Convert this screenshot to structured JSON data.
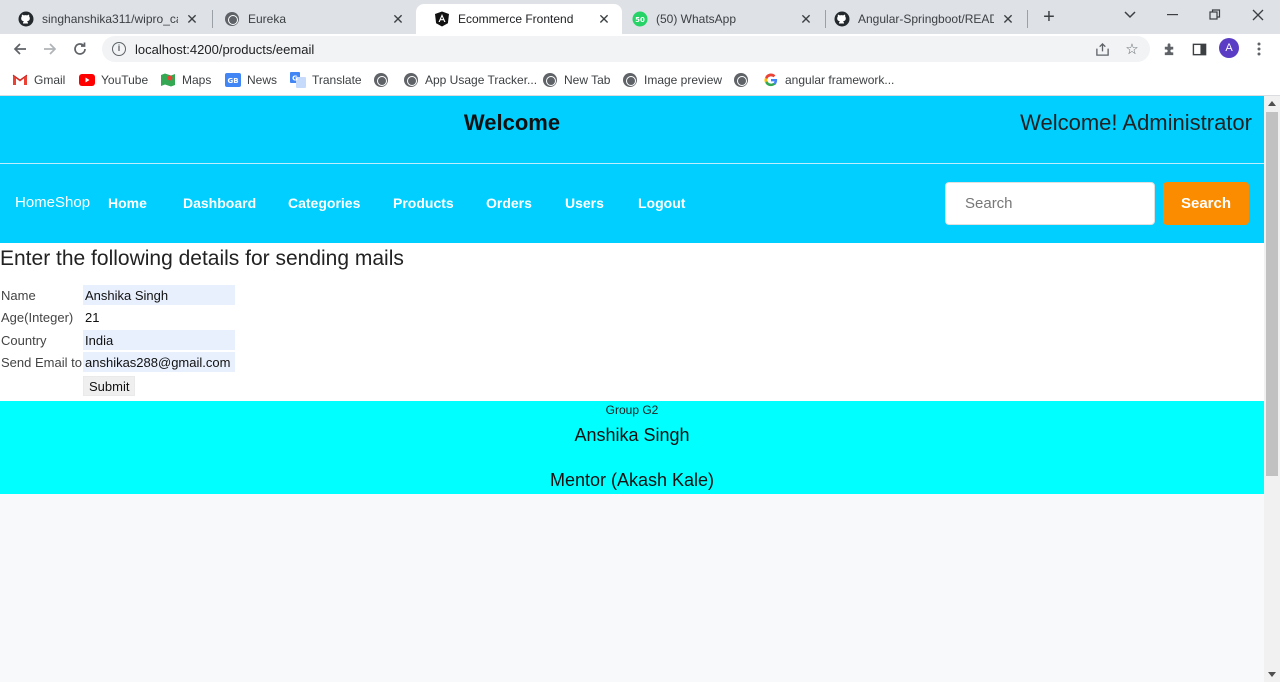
{
  "browser": {
    "tabs": [
      {
        "title": "singhanshika311/wipro_caps",
        "icon": "github-icon"
      },
      {
        "title": "Eureka",
        "icon": "globe-icon"
      },
      {
        "title": "Ecommerce Frontend",
        "icon": "angular-icon"
      },
      {
        "title": "(50) WhatsApp",
        "icon": "whatsapp-icon",
        "badge": "50"
      },
      {
        "title": "Angular-Springboot/READM",
        "icon": "github-icon"
      }
    ],
    "active_tab": 2,
    "url": "localhost:4200/products/eemail",
    "avatar_letter": "A",
    "bookmarks": [
      {
        "label": "Gmail",
        "icon": "gmail-icon"
      },
      {
        "label": "YouTube",
        "icon": "youtube-icon"
      },
      {
        "label": "Maps",
        "icon": "maps-icon"
      },
      {
        "label": "News",
        "icon": "news-icon"
      },
      {
        "label": "Translate",
        "icon": "translate-icon"
      },
      {
        "label": "",
        "icon": "globe-icon"
      },
      {
        "label": "App Usage Tracker...",
        "icon": "globe-icon"
      },
      {
        "label": "New Tab",
        "icon": "globe-icon"
      },
      {
        "label": "Image preview",
        "icon": "globe-icon"
      },
      {
        "label": "",
        "icon": "globe-icon"
      },
      {
        "label": "angular framework...",
        "icon": "google-icon"
      }
    ]
  },
  "header": {
    "welcome": "Welcome",
    "admin": "Welcome! Administrator"
  },
  "nav": {
    "brand": "HomeShop",
    "links": [
      "Home",
      "Dashboard",
      "Categories",
      "Products",
      "Orders",
      "Users",
      "Logout"
    ],
    "search_placeholder": "Search",
    "search_button": "Search"
  },
  "form": {
    "heading": "Enter the following details for sending mails",
    "fields": [
      {
        "label": "Name",
        "value": "Anshika Singh"
      },
      {
        "label": "Age(Integer)",
        "value": "21"
      },
      {
        "label": "Country",
        "value": "India"
      },
      {
        "label": "Send Email to",
        "value": "anshikas288@gmail.com"
      }
    ],
    "submit": "Submit"
  },
  "footer": {
    "group": "Group G2",
    "name": "Anshika Singh",
    "mentor": "Mentor (Akash Kale)"
  },
  "colors": {
    "nav_bg": "#00cfff",
    "footer_bg": "#00ffff",
    "search_button": "#fb8c00"
  }
}
